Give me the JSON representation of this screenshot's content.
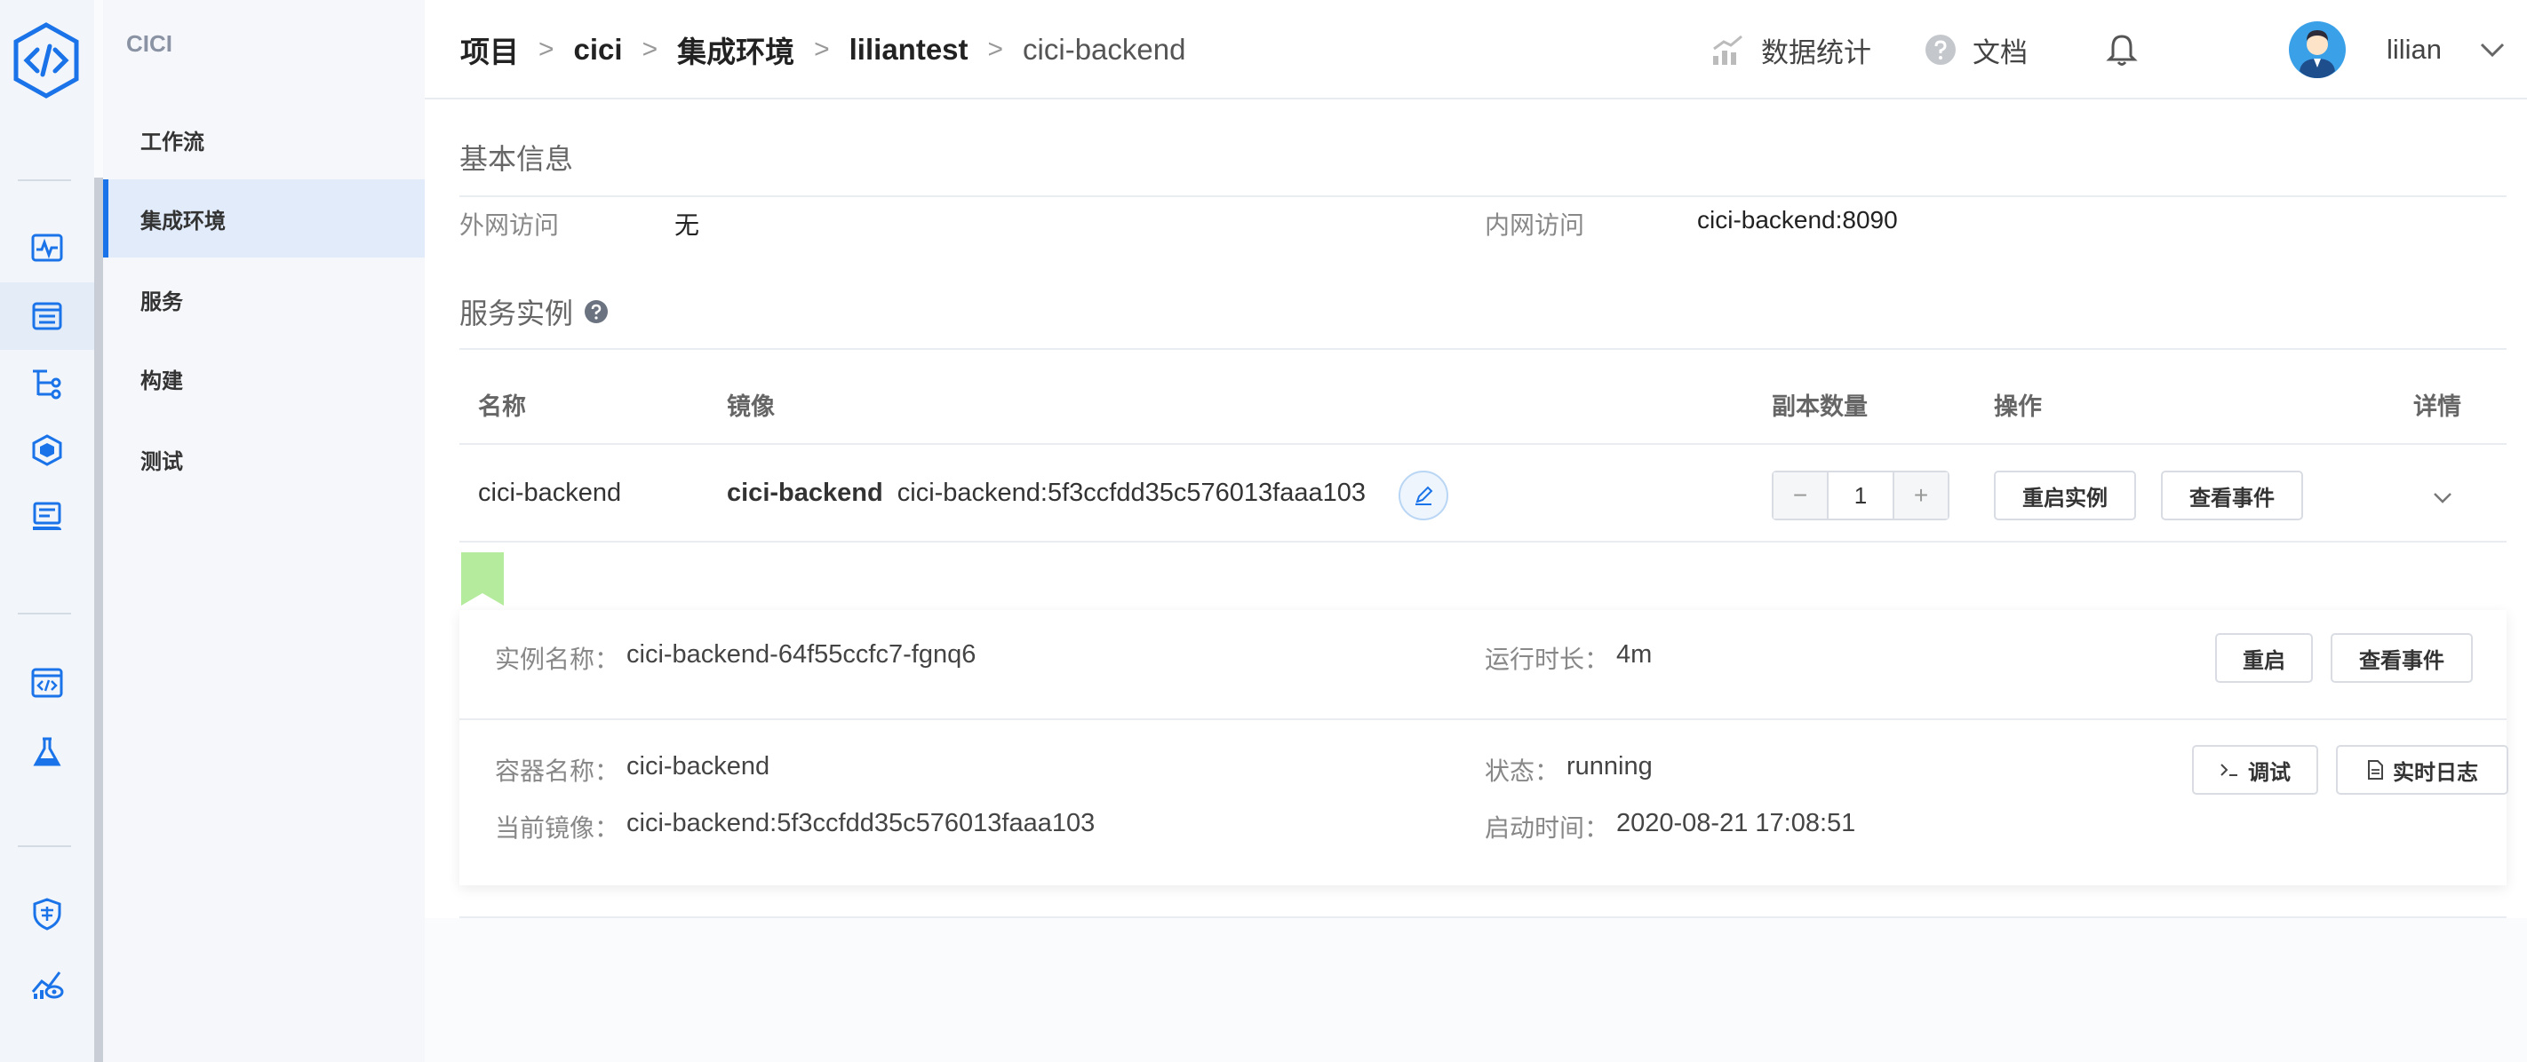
{
  "subnav": {
    "title": "CICI",
    "items": [
      {
        "label": "工作流"
      },
      {
        "label": "集成环境"
      },
      {
        "label": "服务"
      },
      {
        "label": "构建"
      },
      {
        "label": "测试"
      }
    ]
  },
  "header": {
    "breadcrumb": [
      "项目",
      "cici",
      "集成环境",
      "liliantest",
      "cici-backend"
    ],
    "separator": ">",
    "stats_label": "数据统计",
    "docs_label": "文档",
    "user_name": "lilian"
  },
  "basic_info": {
    "title": "基本信息",
    "external_label": "外网访问",
    "external_value": "无",
    "internal_label": "内网访问",
    "internal_value": "cici-backend:8090"
  },
  "service_instances": {
    "title": "服务实例",
    "columns": {
      "name": "名称",
      "image": "镜像",
      "replicas": "副本数量",
      "actions": "操作",
      "details": "详情"
    },
    "row": {
      "name": "cici-backend",
      "image_name": "cici-backend",
      "image_tag": "cici-backend:5f3ccfdd35c576013faaa103",
      "replicas": "1",
      "restart_label": "重启实例",
      "events_label": "查看事件"
    }
  },
  "instance": {
    "name_label": "实例名称：",
    "name_value": "cici-backend-64f55ccfc7-fgnq6",
    "uptime_label": "运行时长：",
    "uptime_value": "4m",
    "restart_label": "重启",
    "events_label": "查看事件",
    "container_label": "容器名称：",
    "container_value": "cici-backend",
    "status_label": "状态：",
    "status_value": "running",
    "debug_label": "调试",
    "logs_label": "实时日志",
    "image_label": "当前镜像：",
    "image_value": "cici-backend:5f3ccfdd35c576013faaa103",
    "start_label": "启动时间：",
    "start_value": "2020-08-21 17:08:51"
  },
  "colors": {
    "primary": "#1a73e8",
    "tag_green": "#b4eb9c"
  }
}
